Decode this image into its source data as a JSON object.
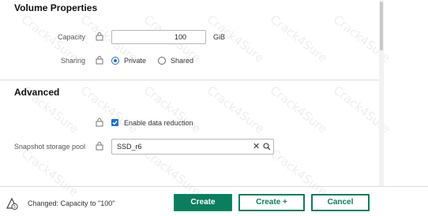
{
  "volume_properties": {
    "title": "Volume Properties",
    "capacity_label": "Capacity",
    "capacity_value": "100",
    "capacity_unit": "GiB",
    "sharing_label": "Sharing",
    "sharing_options": [
      "Private",
      "Shared"
    ],
    "sharing_selected": "Private"
  },
  "advanced": {
    "title": "Advanced",
    "data_reduction_label": "Enable data reduction",
    "data_reduction_checked": true,
    "snapshot_pool_label": "Snapshot storage pool",
    "snapshot_pool_value": "SSD_r6"
  },
  "footer": {
    "changed_text": "Changed: Capacity to \"100\"",
    "create_label": "Create",
    "create_plus_label": "Create +",
    "cancel_label": "Cancel"
  },
  "watermark_text": "Crack4Sure",
  "colors": {
    "primary": "#0b7e5d",
    "accent_blue": "#1d6fd2"
  },
  "icons": [
    "lock-icon",
    "clear-icon",
    "search-icon",
    "changes-icon"
  ]
}
